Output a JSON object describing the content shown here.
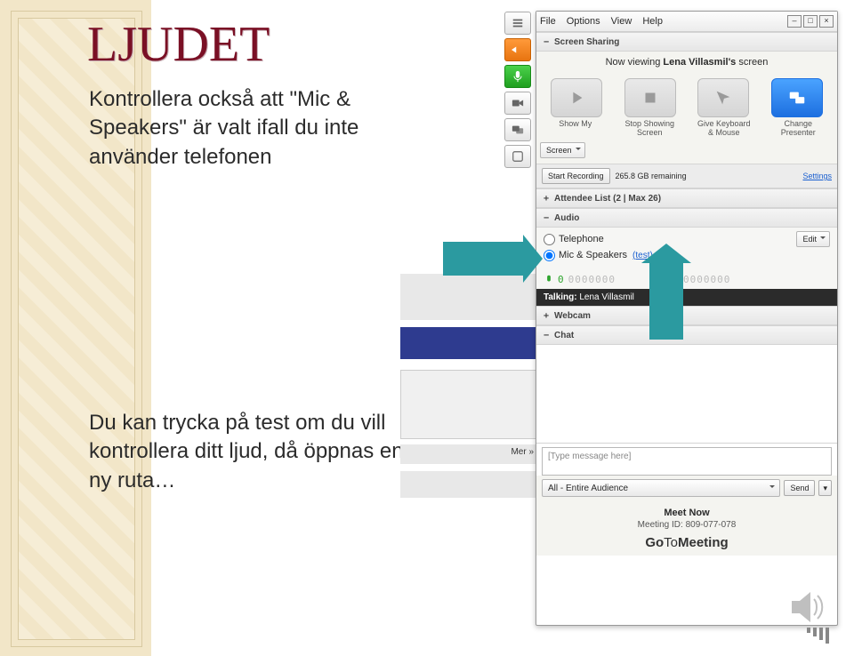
{
  "slide": {
    "title": "LJUDET",
    "para1": "Kontrollera också att \"Mic & Speakers\" är valt ifall du inte använder telefonen",
    "para2": "Du kan trycka på test om du vill kontrollera ditt ljud, då öppnas en ny ruta…"
  },
  "panel": {
    "menu": {
      "file": "File",
      "options": "Options",
      "view": "View",
      "help": "Help"
    },
    "win": {
      "min": "–",
      "max": "□",
      "close": "×"
    },
    "screenShare": {
      "head": "Screen Sharing",
      "nowViewing_pre": "Now viewing ",
      "nowViewing_name": "Lena Villasmil's",
      "nowViewing_post": " screen",
      "btnLabels": {
        "showMy": "Show My",
        "screenSel": "Screen",
        "stop": "Stop Showing Screen",
        "give": "Give Keyboard & Mouse",
        "change": "Change Presenter"
      }
    },
    "recording": {
      "start": "Start Recording",
      "remaining": "265.8 GB remaining",
      "settings": "Settings"
    },
    "attendee": {
      "head": "Attendee List  (2 | Max 26)"
    },
    "audio": {
      "head": "Audio",
      "telephone": "Telephone",
      "micspk": "Mic & Speakers",
      "test": "(test)",
      "edit": "Edit",
      "meter": "0000000",
      "talking_pre": "Talking: ",
      "talking_name": "Lena Villasmil"
    },
    "webcam": {
      "head": "Webcam"
    },
    "chat": {
      "head": "Chat",
      "placeholder": "[Type message here]",
      "audience": "All - Entire Audience",
      "send": "Send"
    },
    "footer": {
      "meetNow": "Meet Now",
      "meetingIdLabel": "Meeting ID: ",
      "meetingId": "809-077-078",
      "brand_go": "Go",
      "brand_to": "To",
      "brand_meet": "Meeting"
    }
  },
  "bgFragment": {
    "mer": "Mer »"
  }
}
